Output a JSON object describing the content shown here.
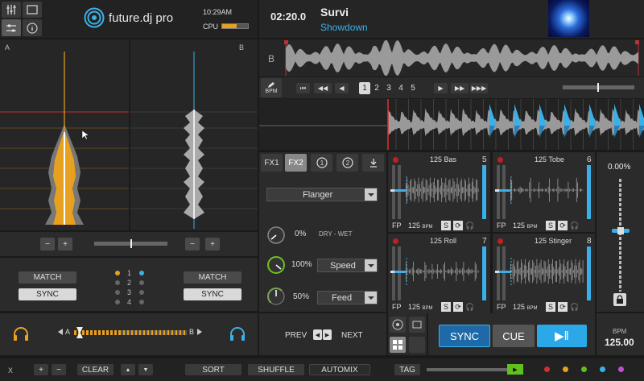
{
  "colors": {
    "deck_a": "#e8a020",
    "deck_b": "#3ab0e8",
    "bg": "#1a1a1a",
    "panel": "#2b2b2b",
    "accent_red": "#d03030",
    "green": "#5fc020"
  },
  "header": {
    "logo_text": "future.dj pro",
    "clock": "10:29AM",
    "cpu_label": "CPU",
    "cpu_load": 0.55
  },
  "track": {
    "time": "02:20.0",
    "title": "Survi",
    "artist": "Showdown",
    "deck_letter": "B",
    "bpm_label": "BPM"
  },
  "waveform": {
    "deck_a_label": "A",
    "deck_b_label": "B"
  },
  "cue_slots": [
    "1",
    "2",
    "3",
    "4",
    "5"
  ],
  "fx": {
    "fx1": "FX1",
    "fx2": "FX2",
    "effect": "Flanger",
    "dry_wet_value": "0%",
    "dry_wet_label": "DRY - WET",
    "speed_value": "100%",
    "speed_label": "Speed",
    "feed_value": "50%",
    "feed_label": "Feed"
  },
  "samplers": [
    {
      "bpm": "125",
      "name": "Bas",
      "number": "5",
      "bpm_unit": "BPM",
      "fp": "FP",
      "s": "S"
    },
    {
      "bpm": "125",
      "name": "Tobe",
      "number": "6",
      "bpm_unit": "BPM",
      "fp": "FP",
      "s": "S"
    },
    {
      "bpm": "125",
      "name": "Roll",
      "number": "7",
      "bpm_unit": "BPM",
      "fp": "FP",
      "s": "S"
    },
    {
      "bpm": "125",
      "name": "Stinger",
      "number": "8",
      "bpm_unit": "BPM",
      "fp": "FP",
      "s": "S"
    }
  ],
  "pitch": {
    "value": "0.00%"
  },
  "left_controls": {
    "minus": "−",
    "plus": "+",
    "match": "MATCH",
    "sync": "SYNC",
    "decks": [
      "1",
      "2",
      "3",
      "4"
    ]
  },
  "crossfader": {
    "a": "A",
    "b": "B"
  },
  "nav": {
    "prev": "PREV",
    "next": "NEXT"
  },
  "transport": {
    "sync": "SYNC",
    "cue": "CUE"
  },
  "bpm_box": {
    "label": "BPM",
    "value": "125.00"
  },
  "bottom": {
    "x": "X",
    "plus": "+",
    "minus": "−",
    "clear": "CLEAR",
    "sort": "SORT",
    "shuffle": "SHUFFLE",
    "automix": "AUTOMIX",
    "tag": "TAG"
  }
}
